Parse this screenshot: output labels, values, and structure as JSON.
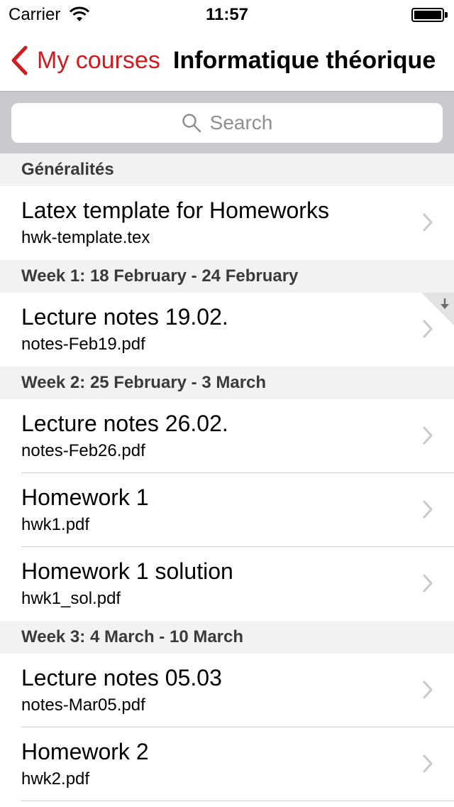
{
  "status_bar": {
    "carrier": "Carrier",
    "time": "11:57"
  },
  "nav": {
    "back_label": "My courses",
    "title": "Informatique théorique",
    "accent_color": "#d21a1f"
  },
  "search": {
    "placeholder": "Search"
  },
  "sections": [
    {
      "header": "Généralités",
      "items": [
        {
          "title": "Latex template for Homeworks",
          "filename": "hwk-template.tex"
        }
      ]
    },
    {
      "header": "Week 1: 18 February - 24 February",
      "items": [
        {
          "title": "Lecture notes 19.02.",
          "filename": "notes-Feb19.pdf",
          "downloaded_badge": "download-arrow-icon"
        }
      ]
    },
    {
      "header": "Week 2: 25 February - 3 March",
      "items": [
        {
          "title": "Lecture notes 26.02.",
          "filename": "notes-Feb26.pdf"
        },
        {
          "title": "Homework 1",
          "filename": "hwk1.pdf"
        },
        {
          "title": "Homework 1 solution",
          "filename": "hwk1_sol.pdf"
        }
      ]
    },
    {
      "header": "Week 3: 4 March - 10 March",
      "items": [
        {
          "title": "Lecture notes 05.03",
          "filename": "notes-Mar05.pdf"
        },
        {
          "title": "Homework 2",
          "filename": "hwk2.pdf"
        }
      ]
    }
  ]
}
